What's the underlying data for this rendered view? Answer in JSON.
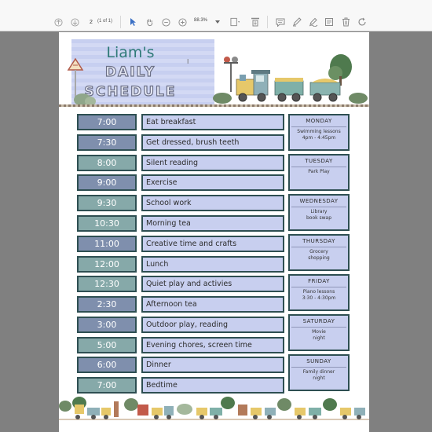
{
  "toolbar": {
    "page_number": "2",
    "page_of": "(1 of 1)",
    "zoom": "88.3%"
  },
  "schedule": {
    "title_name": "Liam's",
    "title_line1": "DAILY",
    "title_line2": "SCHEDULE",
    "rows": [
      {
        "time": "7:00",
        "activity": "Eat breakfast"
      },
      {
        "time": "7:30",
        "activity": "Get dressed, brush teeth"
      },
      {
        "time": "8:00",
        "activity": "Silent reading"
      },
      {
        "time": "9:00",
        "activity": "Exercise"
      },
      {
        "time": "9:30",
        "activity": "School work"
      },
      {
        "time": "10:30",
        "activity": "Morning tea"
      },
      {
        "time": "11:00",
        "activity": "Creative time and crafts"
      },
      {
        "time": "12:00",
        "activity": "Lunch"
      },
      {
        "time": "12:30",
        "activity": "Quiet play and activies"
      },
      {
        "time": "2:30",
        "activity": "Afternoon tea"
      },
      {
        "time": "3:00",
        "activity": "Outdoor play, reading"
      },
      {
        "time": "5:00",
        "activity": "Evening chores, screen time"
      },
      {
        "time": "6:00",
        "activity": "Dinner"
      },
      {
        "time": "7:00",
        "activity": "Bedtime"
      }
    ],
    "days": [
      {
        "name": "MONDAY",
        "line1": "Swimming lessons",
        "line2": "4pm - 4:45pm"
      },
      {
        "name": "TUESDAY",
        "line1": "Park Play",
        "line2": ""
      },
      {
        "name": "WEDNESDAY",
        "line1": "Library",
        "line2": "book swap"
      },
      {
        "name": "THURSDAY",
        "line1": "Grocery",
        "line2": "shopping"
      },
      {
        "name": "FRIDAY",
        "line1": "Piano lessons",
        "line2": "3:30 - 4:30pm"
      },
      {
        "name": "SATURDAY",
        "line1": "Movie",
        "line2": "night"
      },
      {
        "name": "SUNDAY",
        "line1": "Family dinner",
        "line2": "night"
      }
    ]
  },
  "colors": {
    "time_dark": "#7f8fad",
    "time_teal": "#86a9a9",
    "activity_bg": "#c8cfef",
    "border": "#2e4f52",
    "title_teal": "#2f7a78"
  }
}
